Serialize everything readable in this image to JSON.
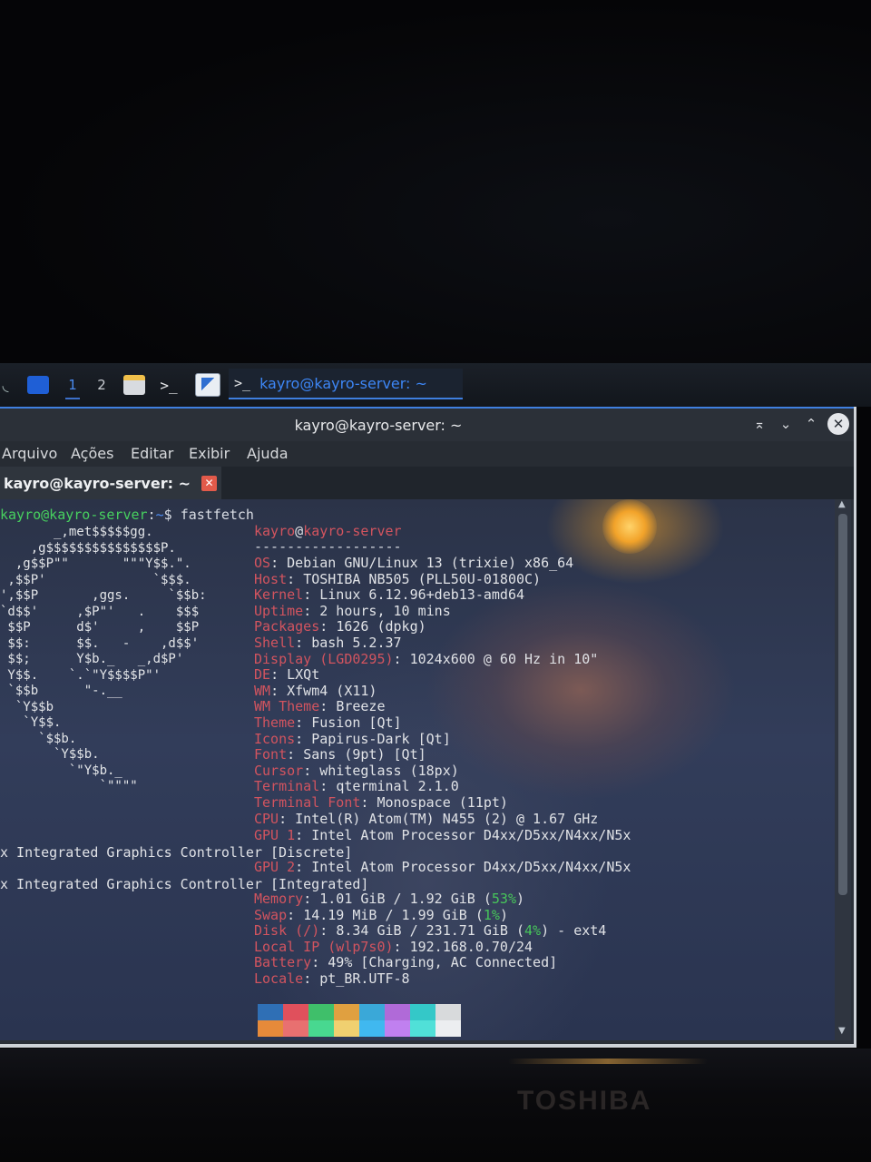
{
  "taskbar": {
    "workspace_1": "1",
    "workspace_2": "2",
    "terminal_glyph": ">_",
    "task_label": "kayro@kayro-server: ~",
    "icons": [
      "menu-icon",
      "chat-icon",
      "file-manager-icon",
      "terminal-icon",
      "text-editor-icon"
    ]
  },
  "window": {
    "title": "kayro@kayro-server: ~",
    "buttons": {
      "keep_above": "⌅",
      "minimize": "⌄",
      "maximize": "⌃",
      "close": "✕"
    }
  },
  "menu": {
    "arquivo": "Arquivo",
    "acoes": "Ações",
    "editar": "Editar",
    "exibir": "Exibir",
    "ajuda": "Ajuda"
  },
  "tab": {
    "label": "kayro@kayro-server: ~",
    "close": "✕"
  },
  "terminal": {
    "prompt_user": "kayro@kayro-server",
    "prompt_sep": ":",
    "prompt_path": "~",
    "prompt_symbol": "$ ",
    "command": "fastfetch",
    "logo": "       _,met$$$$$gg.\n    ,g$$$$$$$$$$$$$$$P.\n  ,g$$P\"\"       \"\"\"Y$$.\".\n ,$$P'              `$$$.\n',$$P       ,ggs.     `$$b:\n`d$$'     ,$P\"'   .    $$$\n $$P      d$'     ,    $$P\n $$:      $$.   -    ,d$$'\n $$;      Y$b._   _,d$P'\n Y$$.    `.`\"Y$$$$P\"'\n `$$b      \"-.__\n  `Y$$b\n   `Y$$.\n     `$$b.\n       `Y$$b.\n         `\"Y$b._\n             `\"\"\"\"",
    "header_user": "kayro",
    "header_at": "@",
    "header_host": "kayro-server",
    "separator": "------------------",
    "fields": [
      {
        "key": "OS",
        "value": "Debian GNU/Linux 13 (trixie) x86_64"
      },
      {
        "key": "Host",
        "value": "TOSHIBA NB505 (PLL50U-01800C)"
      },
      {
        "key": "Kernel",
        "value": "Linux 6.12.96+deb13-amd64"
      },
      {
        "key": "Uptime",
        "value": "2 hours, 10 mins"
      },
      {
        "key": "Packages",
        "value": "1626 (dpkg)"
      },
      {
        "key": "Shell",
        "value": "bash 5.2.37"
      },
      {
        "key": "Display (LGD0295)",
        "value": "1024x600 @ 60 Hz in 10\""
      },
      {
        "key": "DE",
        "value": "LXQt"
      },
      {
        "key": "WM",
        "value": "Xfwm4 (X11)"
      },
      {
        "key": "WM Theme",
        "value": "Breeze"
      },
      {
        "key": "Theme",
        "value": "Fusion [Qt]"
      },
      {
        "key": "Icons",
        "value": "Papirus-Dark [Qt]"
      },
      {
        "key": "Font",
        "value": "Sans (9pt) [Qt]"
      },
      {
        "key": "Cursor",
        "value": "whiteglass (18px)"
      },
      {
        "key": "Terminal",
        "value": "qterminal 2.1.0"
      },
      {
        "key": "Terminal Font",
        "value": "Monospace (11pt)"
      },
      {
        "key": "CPU",
        "value": "Intel(R) Atom(TM) N455 (2) @ 1.67 GHz"
      }
    ],
    "gpu1_key": "GPU 1",
    "gpu1_value": "Intel Atom Processor D4xx/D5xx/N4xx/N5x",
    "gpu1_wrap": "x Integrated Graphics Controller [Discrete]",
    "gpu2_key": "GPU 2",
    "gpu2_value": "Intel Atom Processor D4xx/D5xx/N4xx/N5x",
    "gpu2_wrap": "x Integrated Graphics Controller [Integrated]",
    "memory_key": "Memory",
    "memory_value": "1.01 GiB / 1.92 GiB (",
    "memory_pct": "53%",
    "memory_close": ")",
    "swap_key": "Swap",
    "swap_value": "14.19 MiB / 1.99 GiB (",
    "swap_pct": "1%",
    "swap_close": ")",
    "disk_key": "Disk (/)",
    "disk_value": "8.34 GiB / 231.71 GiB (",
    "disk_pct": "4%",
    "disk_close": ") - ext4",
    "ip_key": "Local IP (wlp7s0)",
    "ip_value": "192.168.0.70/24",
    "battery_key": "Battery",
    "battery_value": "49% [Charging, AC Connected]",
    "locale_key": "Locale",
    "locale_value": "pt_BR.UTF-8",
    "palette_dark": [
      "#2f6fb5",
      "#e0505c",
      "#3fbf6a",
      "#e0a040",
      "#3aa8d8",
      "#b06ad8",
      "#34c8c8",
      "#d8dadc"
    ],
    "palette_bright": [
      "#e68a3a",
      "#e87070",
      "#48d890",
      "#f0d070",
      "#40b8f0",
      "#c080f0",
      "#50e0d8",
      "#eceef0"
    ]
  },
  "photo": {
    "brand": "TOSHIBA"
  }
}
